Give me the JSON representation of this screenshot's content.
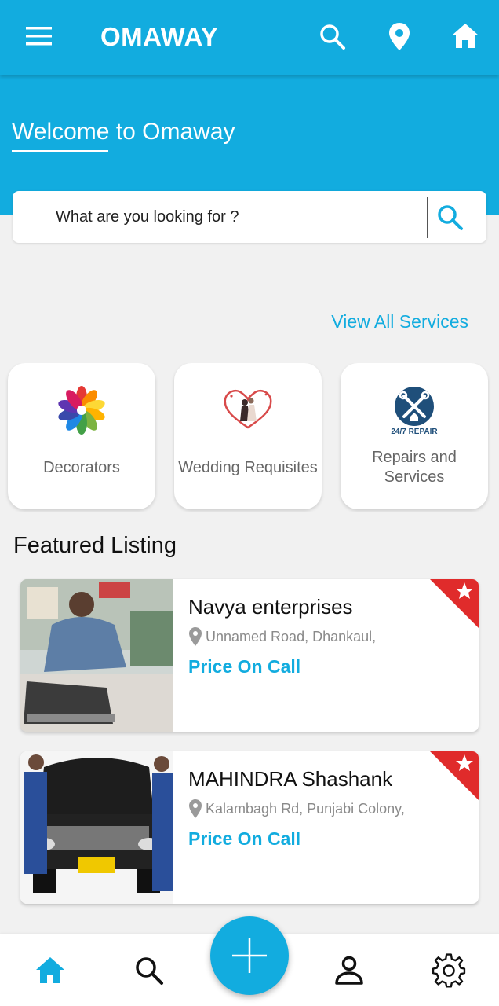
{
  "appbar": {
    "title": "OMAWAY",
    "icons": [
      "menu-icon",
      "search-icon",
      "location-icon",
      "home-icon"
    ],
    "color": "#12acdf"
  },
  "hero": {
    "welcome": "Welcome to Omaway"
  },
  "search": {
    "placeholder": "What are you looking for ?",
    "icon": "search-icon"
  },
  "services": {
    "view_all": "View All Services",
    "items": [
      {
        "label": "Decorators",
        "icon": "flower-logo"
      },
      {
        "label": "Wedding Requisites",
        "icon": "heart-couple-logo"
      },
      {
        "label": "Repairs and Services",
        "icon": "repair-logo",
        "logo_text": "24/7 REPAIR"
      }
    ]
  },
  "featured": {
    "title": "Featured Listing",
    "listings": [
      {
        "name": "Navya enterprises",
        "address": "Unnamed Road, Dhankaul,",
        "price": "Price On Call"
      },
      {
        "name": "MAHINDRA Shashank",
        "address": "Kalambagh Rd, Punjabi Colony,",
        "price": "Price On Call"
      }
    ]
  },
  "bottom_nav": {
    "items": [
      "home-icon",
      "search-icon",
      "add-icon",
      "profile-icon",
      "settings-icon"
    ],
    "active": "home-icon"
  }
}
